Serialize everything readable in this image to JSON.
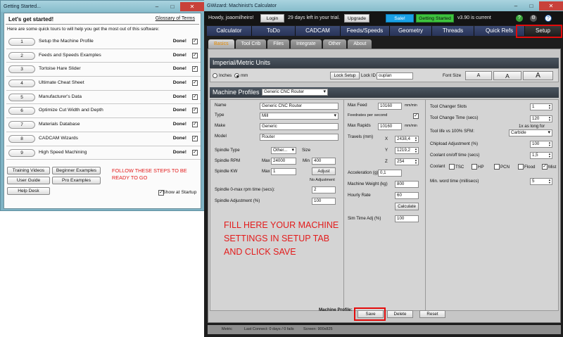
{
  "getting_started": {
    "window_title": "Getting Started...",
    "heading": "Let's get started!",
    "glossary_link": "Glossary of Terms",
    "intro": "Here are some quick tours to will help you get the most out of this software:",
    "steps": [
      {
        "num": "1",
        "label": "Setup the Machine Profile",
        "status": "Done!",
        "checked": true
      },
      {
        "num": "2",
        "label": "Feeds and Speeds Examples",
        "status": "Done!",
        "checked": true
      },
      {
        "num": "3",
        "label": "Tortoise Hare Slider",
        "status": "Done!",
        "checked": true
      },
      {
        "num": "4",
        "label": "Ultimate Cheat Sheet",
        "status": "Done!",
        "checked": true
      },
      {
        "num": "5",
        "label": "Manufacturer's Data",
        "status": "Done!",
        "checked": true
      },
      {
        "num": "6",
        "label": "Optimize Cut Width and Depth",
        "status": "Done!",
        "checked": true
      },
      {
        "num": "7",
        "label": "Materials Database",
        "status": "Done!",
        "checked": true
      },
      {
        "num": "8",
        "label": "CADCAM Wizards",
        "status": "Done!",
        "checked": true
      },
      {
        "num": "9",
        "label": "High Speed Machining",
        "status": "Done!",
        "checked": true
      }
    ],
    "buttons": {
      "training_videos": "Training Videos",
      "beginner_examples": "Beginner Examples",
      "user_guide": "User Guide",
      "pro_examples": "Pro Examples",
      "help_desk": "Help Desk"
    },
    "follow_note": "FOLLOW THESE STEPS TO BE READY TO GO",
    "show_at_startup": "Show at Startup"
  },
  "gwizard": {
    "window_title": "GWizard: Machinist's Calculator",
    "header": {
      "greeting": "Howdy, joaomilheiro!",
      "login": "Login",
      "trial": "29 days left in your trial.",
      "upgrade": "Upgrade",
      "sale": "Sale!",
      "getting_started": "Getting Started",
      "version": "v3.90 is current"
    },
    "tabs": [
      "Calculator",
      "ToDo",
      "CADCAM",
      "Feeds/Speeds",
      "Geometry",
      "Threads",
      "Quick Refs",
      "Setup"
    ],
    "active_tab": "Setup",
    "subtabs": [
      "Basics",
      "Tool Crib",
      "Files",
      "Integrate",
      "Other",
      "About"
    ],
    "active_subtab": "Basics",
    "units": {
      "title": "Imperial/Metric Units",
      "inches": "Inches",
      "mm": "mm",
      "lock_setup": "Lock Setup",
      "lock_id_label": "Lock ID",
      "lock_id_value": "ouplan",
      "font_size": "Font Size",
      "font_a": "A"
    },
    "machine_profiles": {
      "title": "Machine Profiles",
      "selected_profile": "Generic CNC Router",
      "col1": {
        "name_label": "Name",
        "name": "Generic CNC Router",
        "type_label": "Type",
        "type": "Mill",
        "make_label": "Make",
        "make": "Generic",
        "model_label": "Model",
        "model": "Router",
        "spindle_type_label": "Spindle Type",
        "spindle_type": "Other...",
        "size_label": "Size",
        "spindle_rpm_label": "Spindle RPM",
        "max_label": "Max",
        "rpm_max": "24000",
        "min_label": "Min",
        "rpm_min": "400",
        "spindle_kw_label": "Spindle KW",
        "kw": "1",
        "adjust": "Adjust",
        "no_adjustment": "No Adjustment",
        "spindle_time_label": "Spindle 0-max rpm time (secs):",
        "spindle_time": "2",
        "spindle_adj_label": "Spindle Adjustment (%)",
        "spindle_adj": "100"
      },
      "col2": {
        "max_feed_label": "Max Feed",
        "max_feed": "10160",
        "feed_unit": "mm/min",
        "feedrates_label": "Feedrates per second",
        "max_rapids_label": "Max Rapids",
        "max_rapids": "10160",
        "rapids_unit": "mm/min",
        "travels_label": "Travels (mm)",
        "x_label": "X",
        "x": "2438,4",
        "y_label": "Y",
        "y": "1219,2",
        "z_label": "Z",
        "z": "254",
        "accel_label": "Acceleration (g)",
        "accel": "0,1",
        "weight_label": "Machine Weight (kg)",
        "weight": "800",
        "hourly_label": "Hourly Rate",
        "hourly": "60",
        "calculate": "Calculate",
        "sim_time_label": "Sim Time Adj (%)",
        "sim_time": "100"
      },
      "col3": {
        "changer_slots_label": "Tool Changer Slots",
        "changer_slots": "1",
        "change_time_label": "Tool Change Time (secs)",
        "change_time": "120",
        "tool_life_label": "Tool life vs 100% SFM:",
        "as_long_for": "1x as long for",
        "tool_material": "Carbide",
        "chipload_label": "Chipload Adjustment (%)",
        "chipload": "100",
        "coolant_time_label": "Coolant on/off time (secs)",
        "coolant_time": "1,5",
        "coolant_label": "Coolant",
        "coolant_opts": [
          "TSC",
          "HP",
          "PCN",
          "Flood",
          "Mist"
        ],
        "min_word_label": "Min. word time (millisecs)",
        "min_word": "5"
      }
    },
    "fill_note": "FILL HERE YOUR MACHINE SETTINGS IN SETUP TAB AND CLICK SAVE",
    "bottom": {
      "machine_profile_label": "Machine Profile:",
      "save": "Save",
      "delete": "Delete",
      "reset": "Reset"
    },
    "status": {
      "metric": "Metric",
      "last_connect": "Last Connect: 0 days / 0 fails",
      "screen": "Screen: 900x825"
    },
    "colors": {
      "highlight_red": "#e30b0b",
      "sale_blue": "#1aa1e6",
      "getting_started_green": "#3ec43e",
      "tab_blue": "#2c3961",
      "panel_gray": "#c6c6c6"
    }
  }
}
